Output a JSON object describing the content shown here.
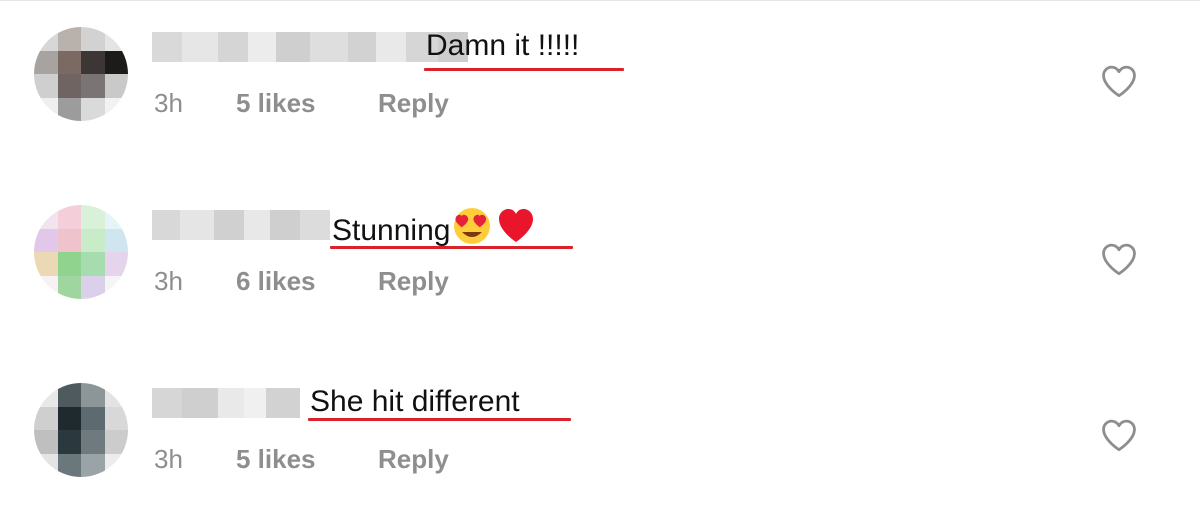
{
  "comments": [
    {
      "text": "Damn it !!!!!",
      "time": "3h",
      "likes": "5 likes",
      "reply": "Reply",
      "liked": false
    },
    {
      "text": "Stunning",
      "emojis": [
        "heart-eyes-emoji",
        "red-heart-emoji"
      ],
      "time": "3h",
      "likes": "6 likes",
      "reply": "Reply",
      "liked": false
    },
    {
      "text": "She hit different",
      "time": "3h",
      "likes": "5 likes",
      "reply": "Reply",
      "liked": false
    }
  ],
  "colors": {
    "meta_text": "#8e8e8e",
    "comment_text": "#111111",
    "highlight_underline": "#d9222a",
    "heart_outline": "#8e8e8e"
  },
  "icons": [
    "heart-outline-icon"
  ]
}
